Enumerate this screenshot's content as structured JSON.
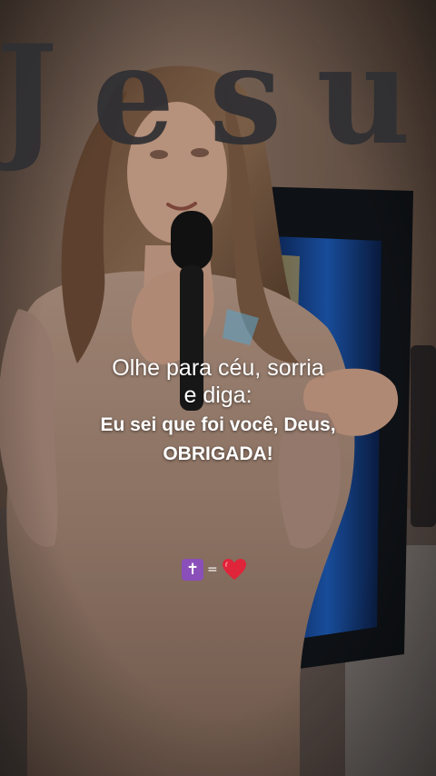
{
  "scene": {
    "description_icon": "woman-holding-microphone-photo",
    "wall_text": "Jesus"
  },
  "caption": {
    "line1": "Olhe para céu, sorria",
    "line2": "e diga:",
    "line3": "Eu sei que foi você, Deus,",
    "line4": "OBRIGADA!"
  },
  "emoji": {
    "cross": "✝",
    "equals": "=",
    "heart_icon": "red-heart-icon"
  },
  "colors": {
    "text": "#ffffff",
    "cross_bg": "#8a4fb8",
    "heart": "#e0243a"
  }
}
